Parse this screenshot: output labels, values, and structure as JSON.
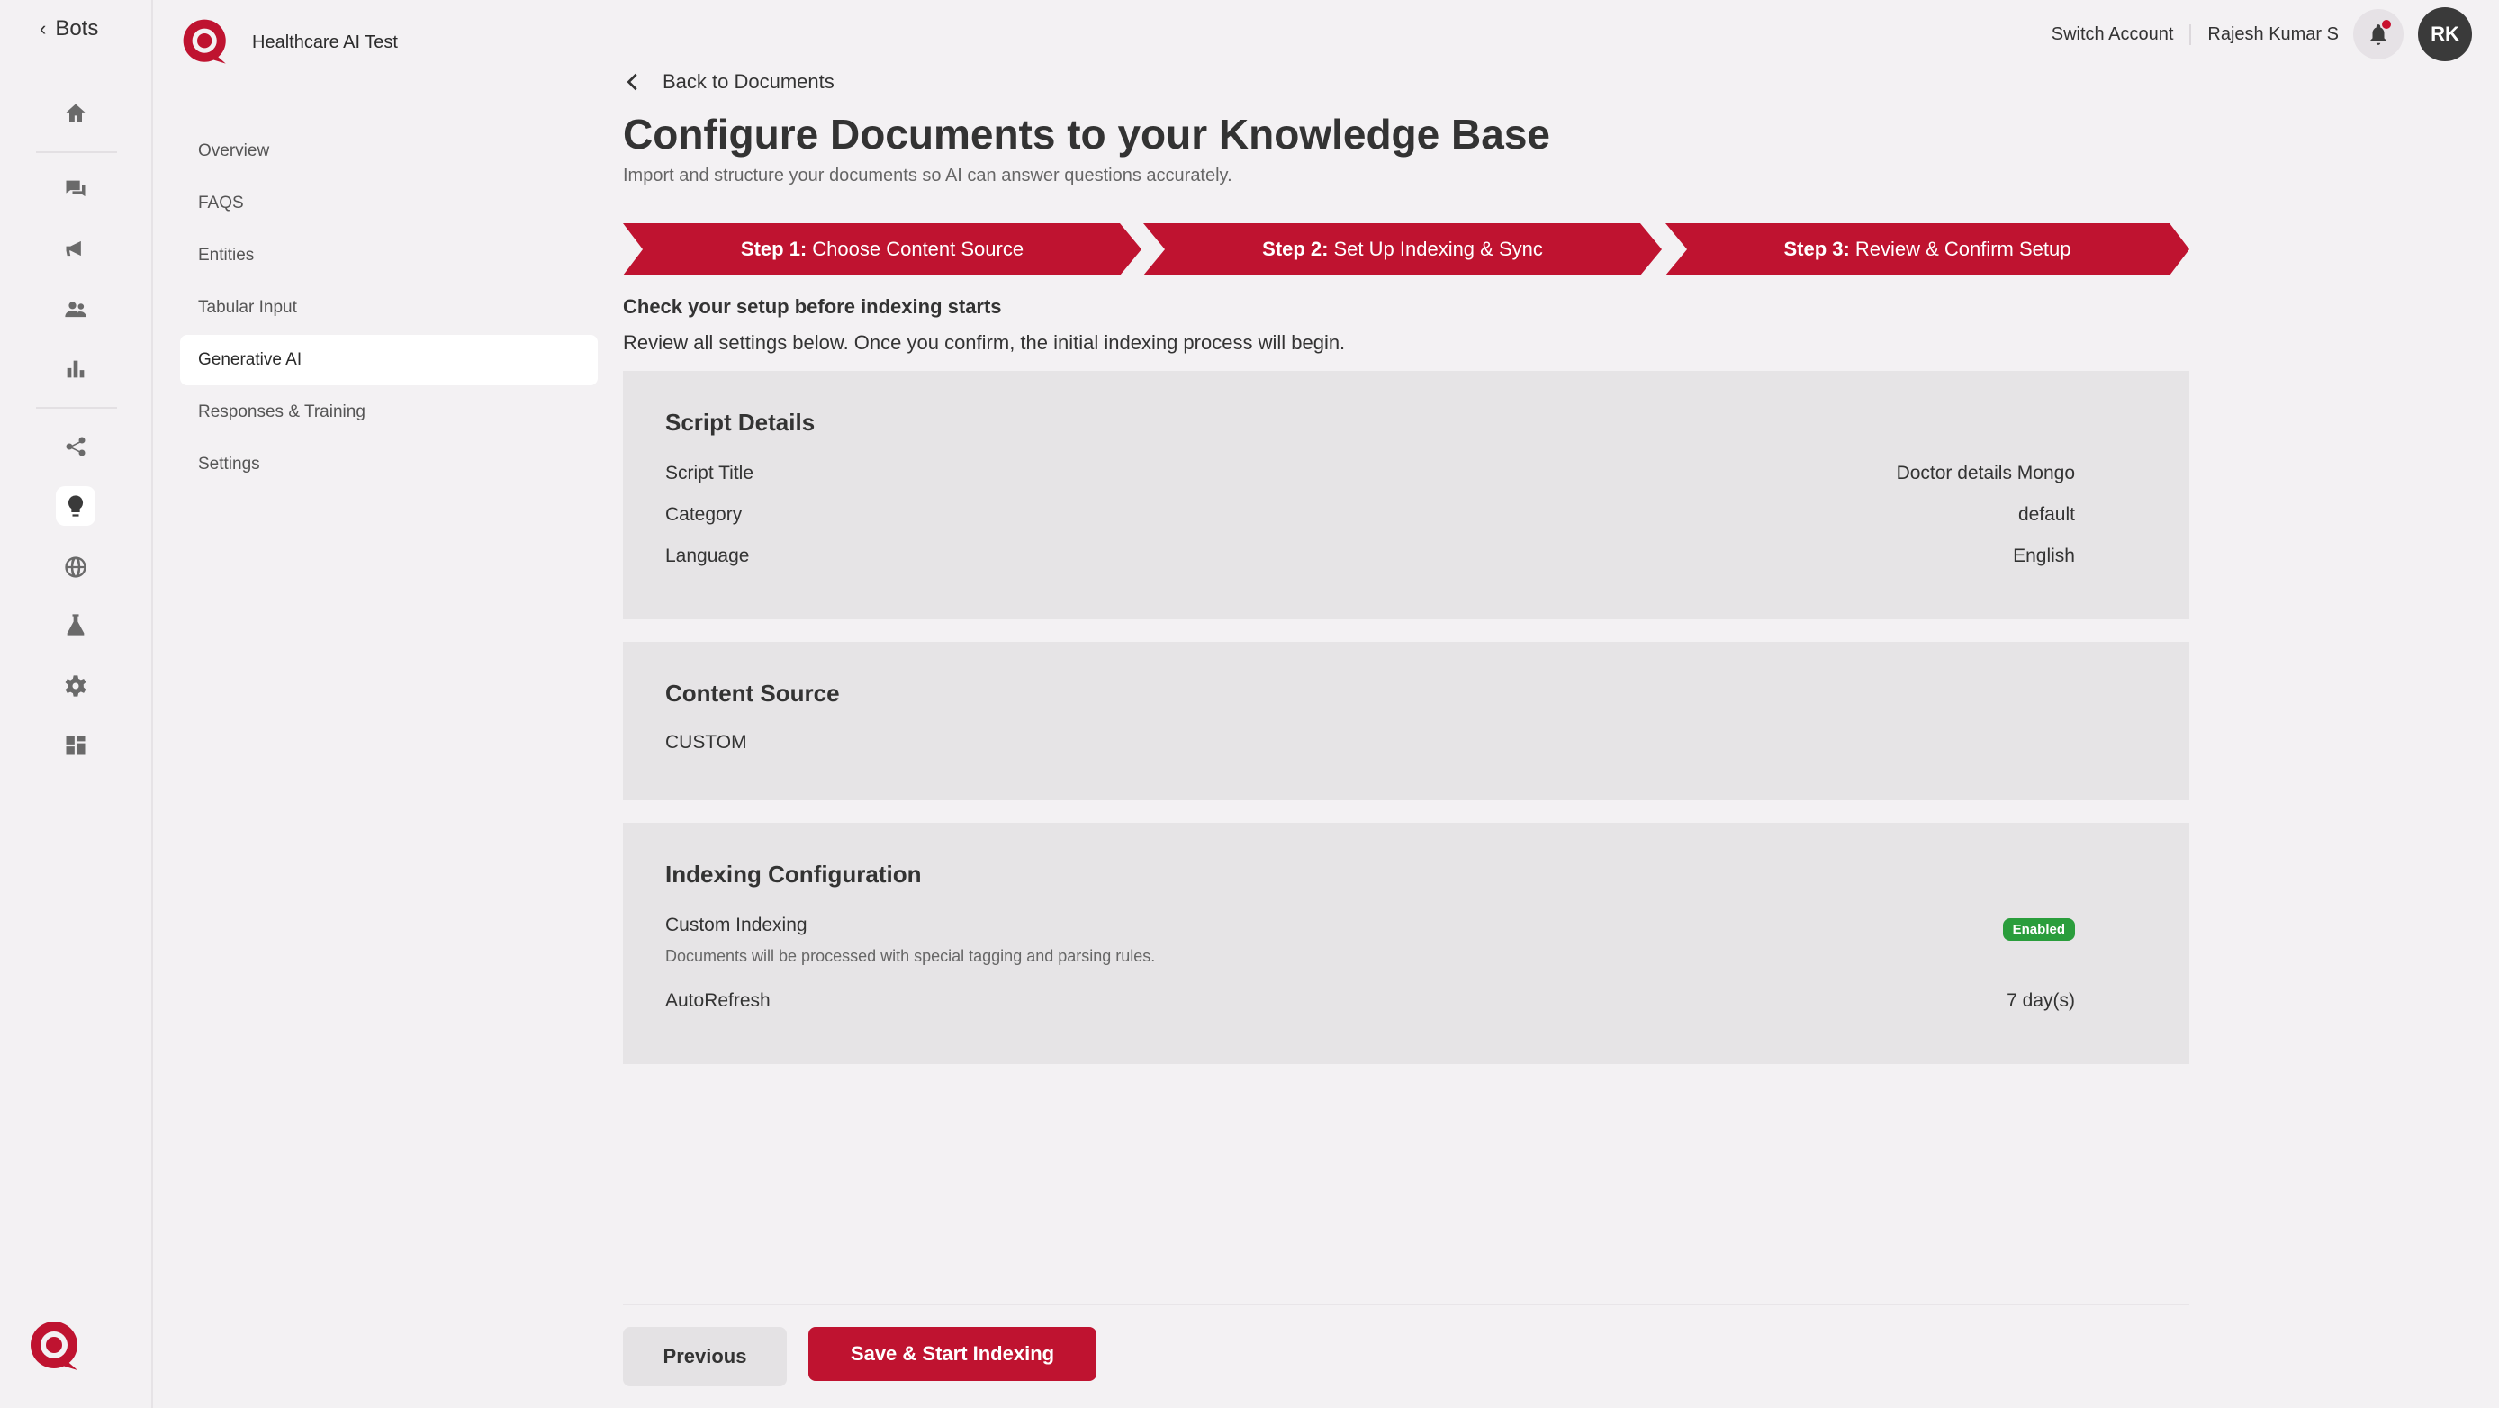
{
  "rail": {
    "back_label": "Bots",
    "icons": [
      "home-icon",
      "chat-icon",
      "megaphone-icon",
      "users-icon",
      "bar-chart-icon",
      "flow-icon",
      "lightbulb-icon",
      "globe-icon",
      "flask-icon",
      "gear-icon",
      "dashboard-icon"
    ]
  },
  "brand": {
    "name": "Healthcare AI Test"
  },
  "subnav": {
    "items": [
      {
        "label": "Overview"
      },
      {
        "label": "FAQS"
      },
      {
        "label": "Entities"
      },
      {
        "label": "Tabular Input"
      },
      {
        "label": "Generative AI"
      },
      {
        "label": "Responses & Training"
      },
      {
        "label": "Settings"
      }
    ],
    "active": "Generative AI"
  },
  "topbar": {
    "switch_account": "Switch Account",
    "user_name": "Rajesh Kumar S",
    "avatar_initials": "RK"
  },
  "page": {
    "back_label": "Back to Documents",
    "title": "Configure Documents to your Knowledge Base",
    "subtitle": "Import and structure your documents so AI can answer questions accurately."
  },
  "steps": [
    {
      "prefix": "Step 1:",
      "label": "Choose Content Source"
    },
    {
      "prefix": "Step 2:",
      "label": "Set Up Indexing & Sync"
    },
    {
      "prefix": "Step 3:",
      "label": "Review & Confirm Setup"
    }
  ],
  "review": {
    "heading": "Check your setup before indexing starts",
    "subheading": "Review all settings below. Once you confirm, the initial indexing process will begin."
  },
  "script_details": {
    "title": "Script Details",
    "rows": [
      {
        "label": "Script Title",
        "value": "Doctor details Mongo"
      },
      {
        "label": "Category",
        "value": "default"
      },
      {
        "label": "Language",
        "value": "English"
      }
    ]
  },
  "content_source": {
    "title": "Content Source",
    "value": "CUSTOM"
  },
  "indexing": {
    "title": "Indexing Configuration",
    "custom_label": "Custom Indexing",
    "custom_badge": "Enabled",
    "custom_desc": "Documents will be processed with special tagging and parsing rules.",
    "autorefresh_label": "AutoRefresh",
    "autorefresh_value": "7 day(s)"
  },
  "actions": {
    "previous": "Previous",
    "save": "Save & Start Indexing"
  },
  "colors": {
    "accent": "#bf1330",
    "success": "#2a9d3c"
  }
}
